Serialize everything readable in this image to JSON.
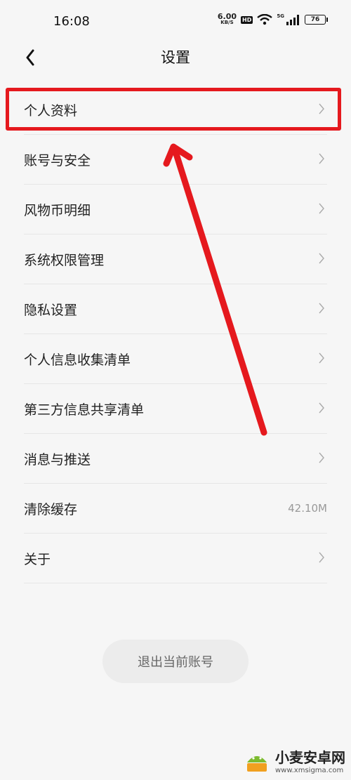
{
  "status_bar": {
    "time": "16:08",
    "net_speed_value": "6.00",
    "net_speed_unit": "KB/S",
    "hd_label": "HD",
    "signal_label": "5G",
    "battery": "76"
  },
  "header": {
    "title": "设置"
  },
  "settings": {
    "items": [
      {
        "label": "个人资料"
      },
      {
        "label": "账号与安全"
      },
      {
        "label": "风物币明细"
      },
      {
        "label": "系统权限管理"
      },
      {
        "label": "隐私设置"
      },
      {
        "label": "个人信息收集清单"
      },
      {
        "label": "第三方信息共享清单"
      },
      {
        "label": "消息与推送"
      },
      {
        "label": "清除缓存",
        "value": "42.10M"
      },
      {
        "label": "关于"
      }
    ]
  },
  "logout": {
    "label": "退出当前账号"
  },
  "watermark": {
    "name": "小麦安卓网",
    "url": "www.xmsigma.com"
  },
  "colors": {
    "background": "#f6f6f6",
    "annotation_red": "#e5191e",
    "logout_bg": "#ececec"
  }
}
